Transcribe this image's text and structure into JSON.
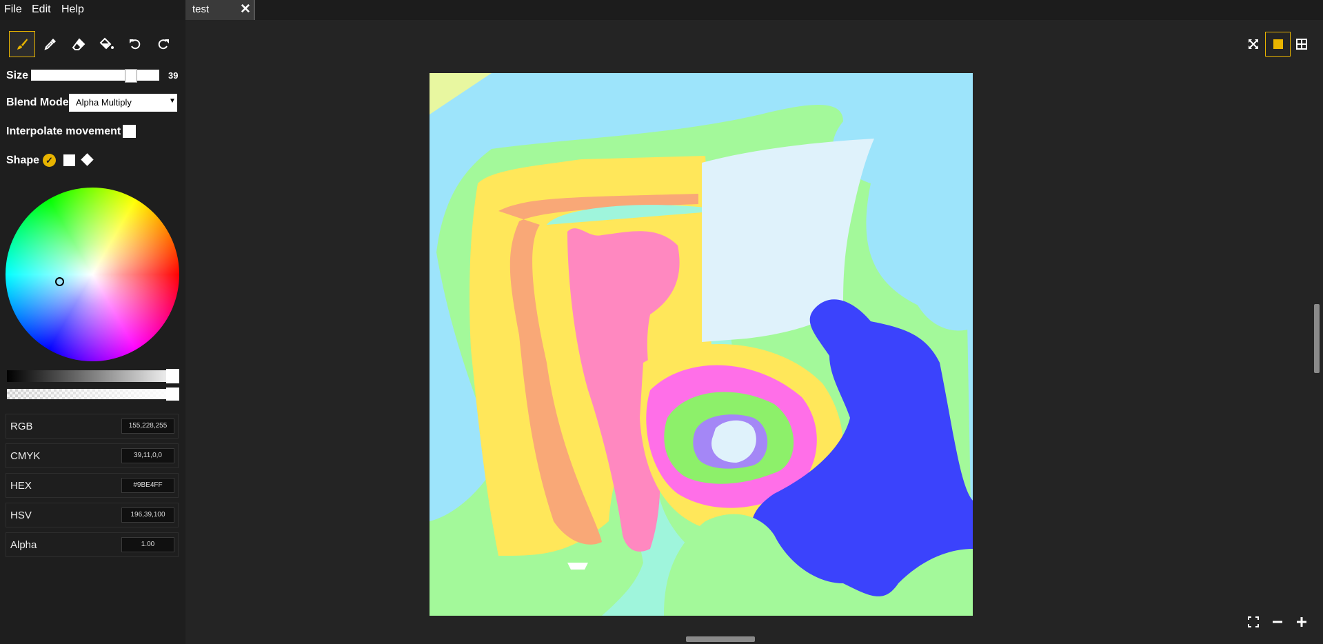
{
  "menubar": {
    "file": "File",
    "edit": "Edit",
    "help": "Help"
  },
  "tab": {
    "label": "test",
    "close_glyph": "✕"
  },
  "tools": [
    {
      "name": "brush",
      "icon": "brush-icon",
      "active": true
    },
    {
      "name": "picker",
      "icon": "eyedropper-icon",
      "active": false
    },
    {
      "name": "eraser",
      "icon": "eraser-icon",
      "active": false
    },
    {
      "name": "fill",
      "icon": "paint-bucket-icon",
      "active": false
    },
    {
      "name": "undo",
      "icon": "undo-icon",
      "active": false
    },
    {
      "name": "redo",
      "icon": "redo-icon",
      "active": false
    }
  ],
  "size": {
    "label": "Size",
    "value": "39",
    "fraction": 0.78
  },
  "blend": {
    "label": "Blend Mode",
    "value": "Alpha Multiply"
  },
  "interpolate": {
    "label": "Interpolate movement",
    "checked": false
  },
  "shape": {
    "label": "Shape",
    "options": [
      "circle",
      "square",
      "diamond"
    ],
    "selected": "circle"
  },
  "color": {
    "current": "#9BE4FF",
    "lightness_fraction": 1.0,
    "alpha_fraction": 1.0,
    "rows": [
      {
        "label": "RGB",
        "value": "155,228,255"
      },
      {
        "label": "CMYK",
        "value": "39,11,0,0"
      },
      {
        "label": "HEX",
        "value": "#9BE4FF"
      },
      {
        "label": "HSV",
        "value": "196,39,100"
      },
      {
        "label": "Alpha",
        "value": "1.00"
      }
    ]
  },
  "view_buttons": [
    {
      "name": "fit-screen",
      "icon": "fit-screen-icon",
      "active": false
    },
    {
      "name": "single-view",
      "icon": "single-view-icon",
      "active": true
    },
    {
      "name": "tile-view",
      "icon": "tile-view-icon",
      "active": false
    }
  ],
  "zoom_buttons": [
    {
      "name": "fullscreen",
      "icon": "fullscreen-icon"
    },
    {
      "name": "zoom-out",
      "icon": "minus-icon"
    },
    {
      "name": "zoom-in",
      "icon": "plus-icon"
    }
  ],
  "palette": {
    "accent": "#e8b400",
    "sky": "#9de4fb",
    "green": "#a3f99a",
    "yellow": "#ffe75a",
    "orange": "#f9a877",
    "pink": "#ff88c0",
    "aqua": "#9ff5dc",
    "pale": "#dff2fb",
    "blue": "#3b43fc",
    "magenta": "#ff6fe8",
    "lime": "#8df06a",
    "lavender": "#a487f6",
    "lemon": "#e8f7a0"
  }
}
